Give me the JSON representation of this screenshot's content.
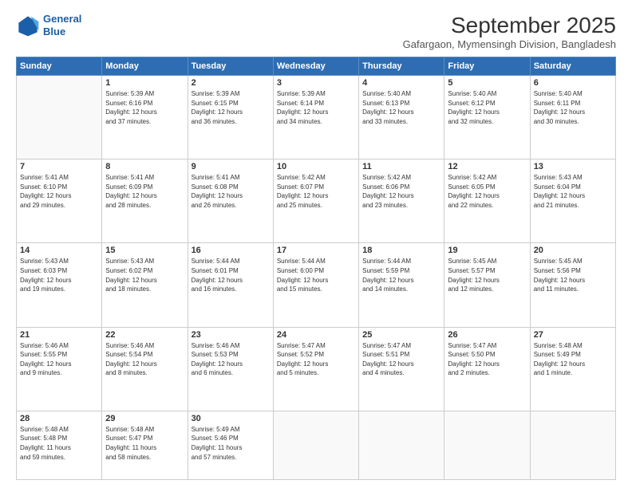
{
  "logo": {
    "line1": "General",
    "line2": "Blue"
  },
  "title": "September 2025",
  "subtitle": "Gafargaon, Mymensingh Division, Bangladesh",
  "weekdays": [
    "Sunday",
    "Monday",
    "Tuesday",
    "Wednesday",
    "Thursday",
    "Friday",
    "Saturday"
  ],
  "weeks": [
    [
      {
        "day": "",
        "info": ""
      },
      {
        "day": "1",
        "info": "Sunrise: 5:39 AM\nSunset: 6:16 PM\nDaylight: 12 hours\nand 37 minutes."
      },
      {
        "day": "2",
        "info": "Sunrise: 5:39 AM\nSunset: 6:15 PM\nDaylight: 12 hours\nand 36 minutes."
      },
      {
        "day": "3",
        "info": "Sunrise: 5:39 AM\nSunset: 6:14 PM\nDaylight: 12 hours\nand 34 minutes."
      },
      {
        "day": "4",
        "info": "Sunrise: 5:40 AM\nSunset: 6:13 PM\nDaylight: 12 hours\nand 33 minutes."
      },
      {
        "day": "5",
        "info": "Sunrise: 5:40 AM\nSunset: 6:12 PM\nDaylight: 12 hours\nand 32 minutes."
      },
      {
        "day": "6",
        "info": "Sunrise: 5:40 AM\nSunset: 6:11 PM\nDaylight: 12 hours\nand 30 minutes."
      }
    ],
    [
      {
        "day": "7",
        "info": "Sunrise: 5:41 AM\nSunset: 6:10 PM\nDaylight: 12 hours\nand 29 minutes."
      },
      {
        "day": "8",
        "info": "Sunrise: 5:41 AM\nSunset: 6:09 PM\nDaylight: 12 hours\nand 28 minutes."
      },
      {
        "day": "9",
        "info": "Sunrise: 5:41 AM\nSunset: 6:08 PM\nDaylight: 12 hours\nand 26 minutes."
      },
      {
        "day": "10",
        "info": "Sunrise: 5:42 AM\nSunset: 6:07 PM\nDaylight: 12 hours\nand 25 minutes."
      },
      {
        "day": "11",
        "info": "Sunrise: 5:42 AM\nSunset: 6:06 PM\nDaylight: 12 hours\nand 23 minutes."
      },
      {
        "day": "12",
        "info": "Sunrise: 5:42 AM\nSunset: 6:05 PM\nDaylight: 12 hours\nand 22 minutes."
      },
      {
        "day": "13",
        "info": "Sunrise: 5:43 AM\nSunset: 6:04 PM\nDaylight: 12 hours\nand 21 minutes."
      }
    ],
    [
      {
        "day": "14",
        "info": "Sunrise: 5:43 AM\nSunset: 6:03 PM\nDaylight: 12 hours\nand 19 minutes."
      },
      {
        "day": "15",
        "info": "Sunrise: 5:43 AM\nSunset: 6:02 PM\nDaylight: 12 hours\nand 18 minutes."
      },
      {
        "day": "16",
        "info": "Sunrise: 5:44 AM\nSunset: 6:01 PM\nDaylight: 12 hours\nand 16 minutes."
      },
      {
        "day": "17",
        "info": "Sunrise: 5:44 AM\nSunset: 6:00 PM\nDaylight: 12 hours\nand 15 minutes."
      },
      {
        "day": "18",
        "info": "Sunrise: 5:44 AM\nSunset: 5:59 PM\nDaylight: 12 hours\nand 14 minutes."
      },
      {
        "day": "19",
        "info": "Sunrise: 5:45 AM\nSunset: 5:57 PM\nDaylight: 12 hours\nand 12 minutes."
      },
      {
        "day": "20",
        "info": "Sunrise: 5:45 AM\nSunset: 5:56 PM\nDaylight: 12 hours\nand 11 minutes."
      }
    ],
    [
      {
        "day": "21",
        "info": "Sunrise: 5:46 AM\nSunset: 5:55 PM\nDaylight: 12 hours\nand 9 minutes."
      },
      {
        "day": "22",
        "info": "Sunrise: 5:46 AM\nSunset: 5:54 PM\nDaylight: 12 hours\nand 8 minutes."
      },
      {
        "day": "23",
        "info": "Sunrise: 5:46 AM\nSunset: 5:53 PM\nDaylight: 12 hours\nand 6 minutes."
      },
      {
        "day": "24",
        "info": "Sunrise: 5:47 AM\nSunset: 5:52 PM\nDaylight: 12 hours\nand 5 minutes."
      },
      {
        "day": "25",
        "info": "Sunrise: 5:47 AM\nSunset: 5:51 PM\nDaylight: 12 hours\nand 4 minutes."
      },
      {
        "day": "26",
        "info": "Sunrise: 5:47 AM\nSunset: 5:50 PM\nDaylight: 12 hours\nand 2 minutes."
      },
      {
        "day": "27",
        "info": "Sunrise: 5:48 AM\nSunset: 5:49 PM\nDaylight: 12 hours\nand 1 minute."
      }
    ],
    [
      {
        "day": "28",
        "info": "Sunrise: 5:48 AM\nSunset: 5:48 PM\nDaylight: 11 hours\nand 59 minutes."
      },
      {
        "day": "29",
        "info": "Sunrise: 5:48 AM\nSunset: 5:47 PM\nDaylight: 11 hours\nand 58 minutes."
      },
      {
        "day": "30",
        "info": "Sunrise: 5:49 AM\nSunset: 5:46 PM\nDaylight: 11 hours\nand 57 minutes."
      },
      {
        "day": "",
        "info": ""
      },
      {
        "day": "",
        "info": ""
      },
      {
        "day": "",
        "info": ""
      },
      {
        "day": "",
        "info": ""
      }
    ]
  ]
}
